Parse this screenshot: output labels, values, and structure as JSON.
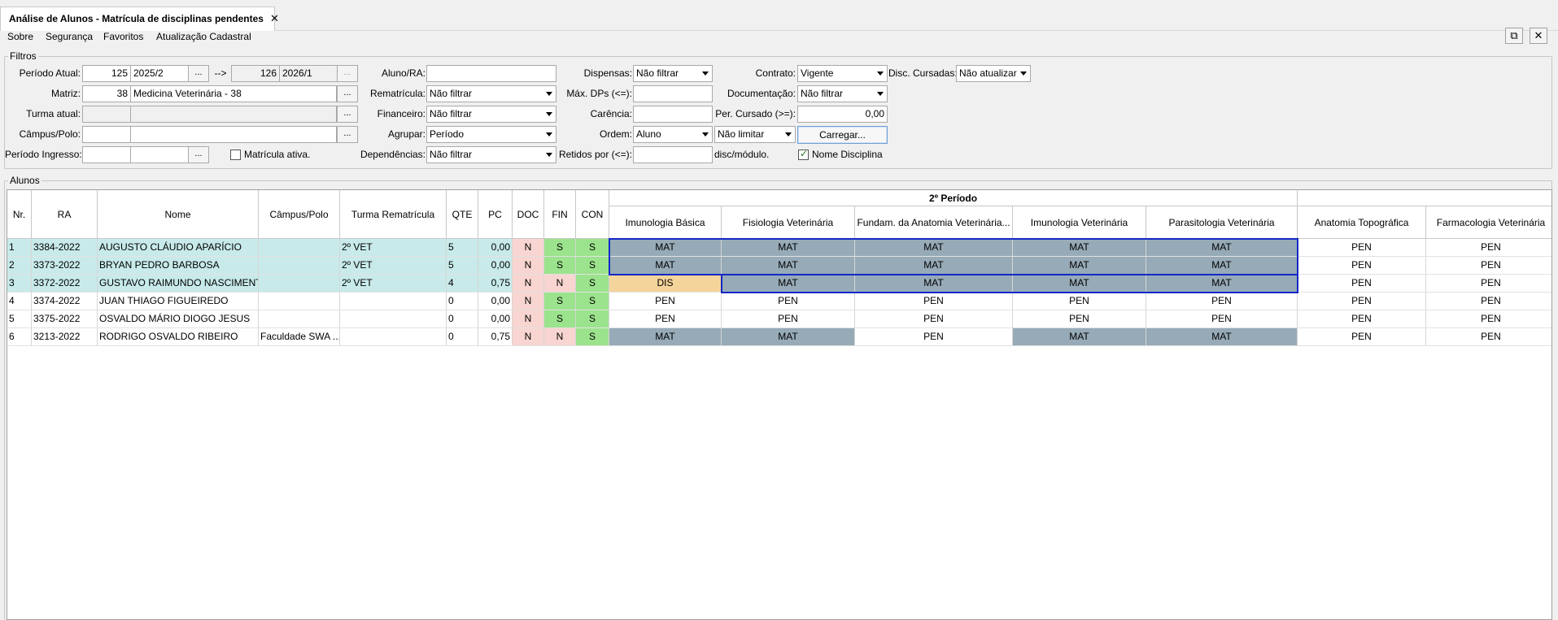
{
  "tab": {
    "title": "Análise de Alunos - Matrícula de disciplinas pendentes",
    "close": "✕"
  },
  "menu": [
    "Sobre",
    "Segurança",
    "Favoritos",
    "Atualização Cadastral"
  ],
  "window_buttons": {
    "detach": "⧉",
    "close": "✕"
  },
  "filters": {
    "title": "Filtros",
    "periodo_atual": {
      "label": "Período Atual:",
      "code": "125",
      "value": "2025/2",
      "arrow": "-->",
      "to_code": "126",
      "to_value": "2026/1"
    },
    "matriz": {
      "label": "Matriz:",
      "code": "38",
      "value": "Medicina Veterinária - 38"
    },
    "turma_atual": {
      "label": "Turma atual:"
    },
    "campus_polo": {
      "label": "Câmpus/Polo:"
    },
    "periodo_ingresso": {
      "label": "Período Ingresso:"
    },
    "matricula_ativa": {
      "label": "Matrícula ativa."
    },
    "aluno_ra": {
      "label": "Aluno/RA:"
    },
    "rematricula": {
      "label": "Rematrícula:",
      "value": "Não filtrar"
    },
    "financeiro": {
      "label": "Financeiro:",
      "value": "Não filtrar"
    },
    "agrupar": {
      "label": "Agrupar:",
      "value": "Período"
    },
    "dependencias": {
      "label": "Dependências:",
      "value": "Não filtrar"
    },
    "dispensas": {
      "label": "Dispensas:",
      "value": "Não filtrar"
    },
    "max_dps": {
      "label": "Máx. DPs (<=):"
    },
    "carencia": {
      "label": "Carência:"
    },
    "ordem": {
      "label": "Ordem:",
      "value": "Aluno",
      "limit": "Não limitar"
    },
    "retidos": {
      "label": "Retidos por (<=):",
      "suffix": "disc/módulo."
    },
    "contrato": {
      "label": "Contrato:",
      "value": "Vigente"
    },
    "documentacao": {
      "label": "Documentação:",
      "value": "Não filtrar"
    },
    "per_cursado": {
      "label": "Per. Cursado (>=):",
      "value": "0,00"
    },
    "carregar": "Carregar...",
    "nome_disciplina": {
      "label": "Nome Disciplina",
      "checked": true
    },
    "disc_cursadas": {
      "label": "Disc. Cursadas:",
      "value": "Não atualizar"
    },
    "dots": "..."
  },
  "alunos": {
    "title": "Alunos",
    "group_header": "2º Período",
    "columns": [
      "Nr.",
      "RA",
      "Nome",
      "Câmpus/Polo",
      "Turma Rematrícula",
      "QTE",
      "PC",
      "DOC",
      "FIN",
      "CON"
    ],
    "disciplinas": [
      "Imunologia Básica",
      "Fisiologia Veterinária",
      "Fundam. da Anatomia Veterinária...",
      "Imunologia Veterinária",
      "Parasitologia Veterinária",
      "Anatomia Topográfica",
      "Farmacologia Veterinária"
    ],
    "rows": [
      {
        "nr": "1",
        "ra": "3384-2022",
        "nome": "AUGUSTO CLÁUDIO APARÍCIO",
        "campus": "",
        "turma": "2º VET",
        "qte": "5",
        "pc": "0,00",
        "doc": "N",
        "fin": "S",
        "con": "S",
        "disc": [
          "MAT",
          "MAT",
          "MAT",
          "MAT",
          "MAT",
          "PEN",
          "PEN"
        ],
        "highlight": true
      },
      {
        "nr": "2",
        "ra": "3373-2022",
        "nome": "BRYAN PEDRO BARBOSA",
        "campus": "",
        "turma": "2º VET",
        "qte": "5",
        "pc": "0,00",
        "doc": "N",
        "fin": "S",
        "con": "S",
        "disc": [
          "MAT",
          "MAT",
          "MAT",
          "MAT",
          "MAT",
          "PEN",
          "PEN"
        ],
        "highlight": true
      },
      {
        "nr": "3",
        "ra": "3372-2022",
        "nome": "GUSTAVO RAIMUNDO NASCIMENTO",
        "campus": "",
        "turma": "2º VET",
        "qte": "4",
        "pc": "0,75",
        "doc": "N",
        "fin": "N",
        "con": "S",
        "disc": [
          "DIS",
          "MAT",
          "MAT",
          "MAT",
          "MAT",
          "PEN",
          "PEN"
        ],
        "highlight": true
      },
      {
        "nr": "4",
        "ra": "3374-2022",
        "nome": "JUAN THIAGO FIGUEIREDO",
        "campus": "",
        "turma": "",
        "qte": "0",
        "pc": "0,00",
        "doc": "N",
        "fin": "S",
        "con": "S",
        "disc": [
          "PEN",
          "PEN",
          "PEN",
          "PEN",
          "PEN",
          "PEN",
          "PEN"
        ],
        "highlight": false
      },
      {
        "nr": "5",
        "ra": "3375-2022",
        "nome": "OSVALDO MÁRIO DIOGO JESUS",
        "campus": "",
        "turma": "",
        "qte": "0",
        "pc": "0,00",
        "doc": "N",
        "fin": "S",
        "con": "S",
        "disc": [
          "PEN",
          "PEN",
          "PEN",
          "PEN",
          "PEN",
          "PEN",
          "PEN"
        ],
        "highlight": false
      },
      {
        "nr": "6",
        "ra": "3213-2022",
        "nome": "RODRIGO OSVALDO RIBEIRO",
        "campus": "Faculdade SWA ...",
        "turma": "",
        "qte": "0",
        "pc": "0,75",
        "doc": "N",
        "fin": "N",
        "con": "S",
        "disc": [
          "MAT",
          "MAT",
          "PEN",
          "MAT",
          "MAT",
          "PEN",
          "PEN"
        ],
        "highlight": false
      }
    ]
  },
  "colors": {
    "highlight_row": "#c8eaea",
    "status_no": "#f8d5d0",
    "status_yes": "#9be38c",
    "mat": "#96aab7",
    "dis": "#f4d49a",
    "selection": "#1428c8"
  }
}
